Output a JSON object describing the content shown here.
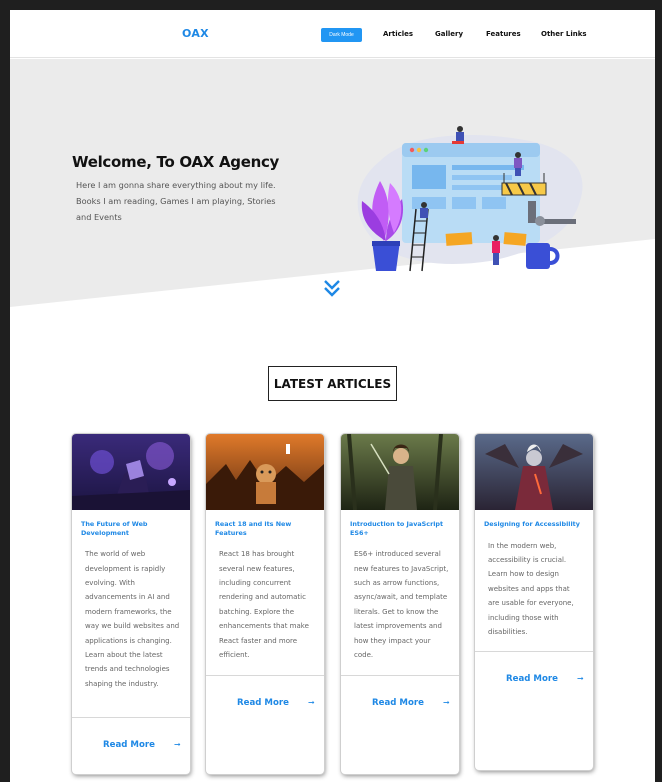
{
  "header": {
    "logo": "OAX",
    "dark_mode_label": "Dark Mode",
    "nav": [
      "Articles",
      "Gallery",
      "Features",
      "Other Links"
    ]
  },
  "hero": {
    "title": "Welcome, To OAX Agency",
    "text": "Here I am gonna share everything about my life. Books I am reading, Games I am playing, Stories and Events"
  },
  "section": {
    "title": "LATEST ARTICLES"
  },
  "articles": [
    {
      "title": "The Future of Web Development",
      "body": "The world of web development is rapidly evolving. With advancements in AI and modern frameworks, the way we build websites and applications is changing. Learn about the latest trends and technologies shaping the industry.",
      "read_more": "Read More"
    },
    {
      "title": "React 18 and its New Features",
      "body": "React 18 has brought several new features, including concurrent rendering and automatic batching. Explore the enhancements that make React faster and more efficient.",
      "read_more": "Read More"
    },
    {
      "title": "Introduction to JavaScript ES6+",
      "body": "ES6+ introduced several new features to JavaScript, such as arrow functions, async/await, and template literals. Get to know the latest improvements and how they impact your code.",
      "read_more": "Read More"
    },
    {
      "title": "Designing for Accessibility",
      "body": "In the modern web, accessibility is crucial. Learn how to design websites and apps that are usable for everyone, including those with disabilities.",
      "read_more": "Read More"
    }
  ],
  "colors": {
    "accent": "#1e88e5",
    "hero_bg": "#ececec",
    "button": "#2196f3"
  },
  "icons": [
    "double-chevron-down-icon",
    "arrow-right-icon"
  ]
}
